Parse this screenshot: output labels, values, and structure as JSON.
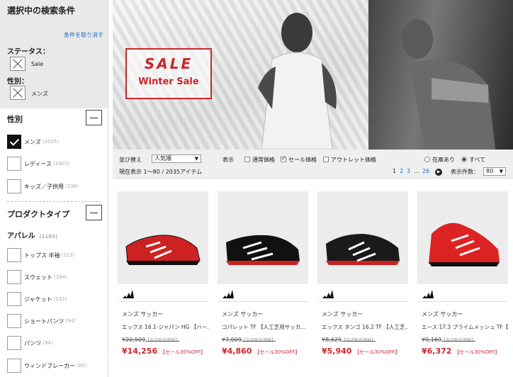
{
  "sidebar": {
    "selected_title": "選択中の検索条件",
    "clear_link": "条件を取り消す",
    "status_label": "ステータス：",
    "status_chip": "Sale",
    "gender_label": "性別：",
    "gender_chip": "メンズ",
    "gender_section": "性別",
    "gender_options": [
      {
        "label": "メンズ",
        "count": "(2035)",
        "checked": true
      },
      {
        "label": "レディース",
        "count": "(1403)",
        "checked": false
      },
      {
        "label": "キッズ／子供用",
        "count": "(336)",
        "checked": false
      }
    ],
    "product_type_section": "プロダクトタイプ",
    "apparel_label": "アパレル",
    "apparel_count": "(1103)",
    "apparel_options": [
      {
        "label": "トップス 半袖",
        "count": "(323)"
      },
      {
        "label": "スウェット",
        "count": "(184)"
      },
      {
        "label": "ジャケット",
        "count": "(132)"
      },
      {
        "label": "ショートパンツ",
        "count": "(94)"
      },
      {
        "label": "パンツ",
        "count": "(84)"
      },
      {
        "label": "ウィンドブレーカー",
        "count": "(80)"
      }
    ]
  },
  "banner": {
    "sale_word": "SALE",
    "sale_sub": "Winter Sale"
  },
  "toolbar": {
    "sort_label": "並び替え",
    "sort_value": "人気順",
    "display_label": "表示",
    "price_regular": "通常価格",
    "price_sale": "セール価格",
    "price_outlet": "アウトレット価格",
    "stock_in": "在庫あり",
    "stock_all": "すべて",
    "showing": "現在表示 1～80 / 2035アイテム",
    "pages": [
      "1",
      "2",
      "3",
      "...",
      "26"
    ],
    "per_page_label": "表示件数：",
    "per_page_value": "80"
  },
  "products": [
    {
      "category": "メンズ サッカー",
      "name": "エックス 16.1-ジャパン HG 【ハー…",
      "old_price": "¥20,509",
      "old_tag": "【自店販売価格】",
      "price": "¥14,256",
      "price_tag": "【セール30%OFF】"
    },
    {
      "category": "メンズ サッカー",
      "name": "コパレット TF 【人工芝用サッカ…",
      "old_price": "¥7,009",
      "old_tag": "【自店販売価格】",
      "price": "¥4,860",
      "price_tag": "【セール30%OFF】"
    },
    {
      "category": "メンズ サッカー",
      "name": "エックス タンゴ 16.2 TF 【人工芝…",
      "old_price": "¥8,629",
      "old_tag": "【自店販売価格】",
      "price": "¥5,940",
      "price_tag": "【セール30%OFF】"
    },
    {
      "category": "メンズ サッカー",
      "name": "エース 17.3 プライムメッシュ TF【…",
      "old_price": "¥9,169",
      "old_tag": "【自店販売価格】",
      "price": "¥6,372",
      "price_tag": "【セール30%OFF】"
    }
  ],
  "colors": {
    "accent_red": "#c8282d",
    "link_blue": "#1a6ec8"
  }
}
